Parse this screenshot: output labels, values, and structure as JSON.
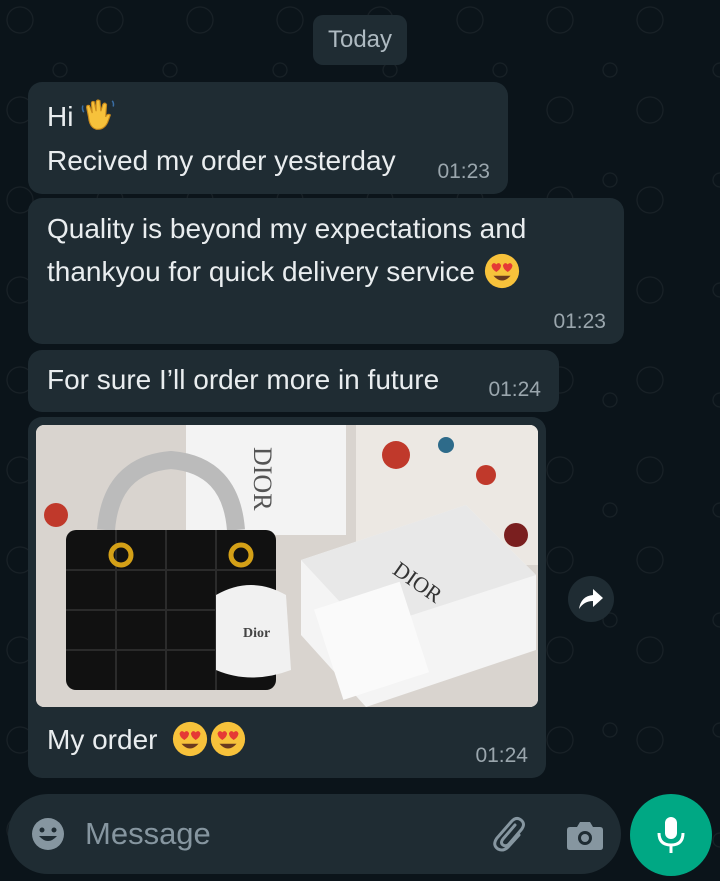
{
  "date_chip": "Today",
  "messages": [
    {
      "lines": [
        "Hi",
        "Recived my order yesterday"
      ],
      "time": "01:23"
    },
    {
      "lines": [
        "Quality is beyond my expectations and",
        "thankyou for quick delivery service"
      ],
      "time": "01:23"
    },
    {
      "lines": [
        "For sure I’ll order more in future"
      ],
      "time": "01:24"
    },
    {
      "caption": "My order",
      "time": "01:24",
      "photo_text": {
        "bag_tag": "DIOR",
        "pouch": "Dior",
        "box": "DIOR"
      }
    }
  ],
  "composer": {
    "placeholder": "Message"
  },
  "icons": {
    "emoji": "emoji-icon",
    "attach": "paperclip-icon",
    "camera": "camera-icon",
    "mic": "microphone-icon",
    "forward": "forward-arrow-icon"
  },
  "colors": {
    "background": "#0b141a",
    "bubble": "#1f2c33",
    "accent": "#00a884",
    "muted": "#8696a0"
  }
}
